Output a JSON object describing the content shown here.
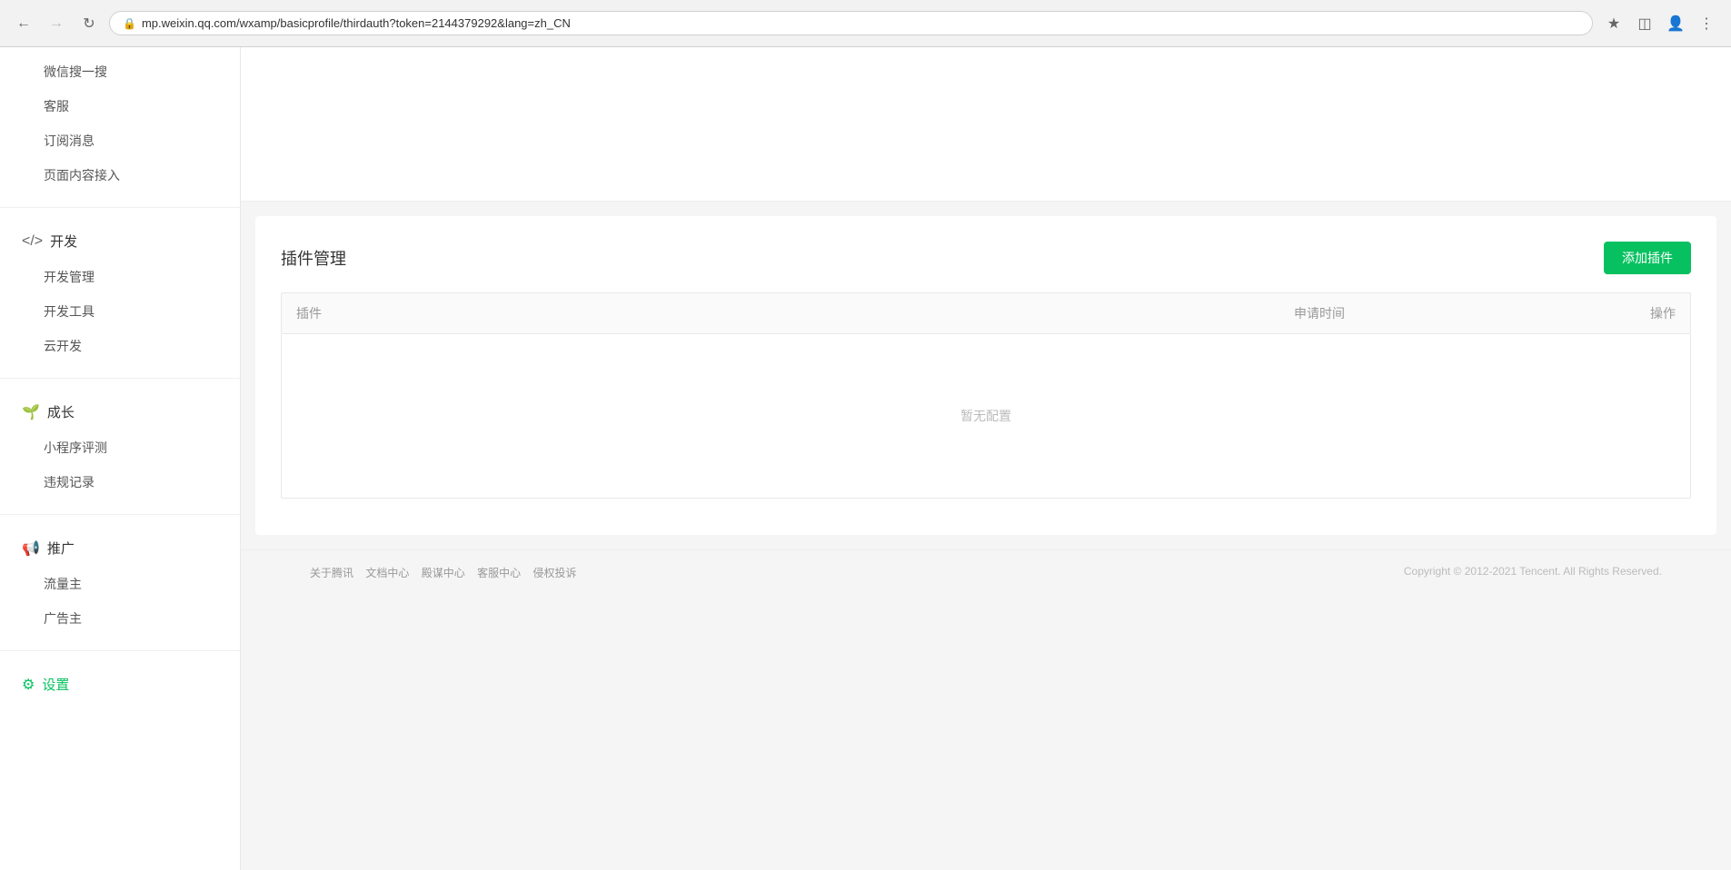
{
  "browser": {
    "url": "mp.weixin.qq.com/wxamp/basicprofile/thirdauth?token=2144379292&lang=zh_CN",
    "back_disabled": false,
    "forward_disabled": true
  },
  "sidebar": {
    "sections": [
      {
        "id": "weixin-search",
        "label": "微信搜一搜",
        "icon": "",
        "items": []
      },
      {
        "id": "kefu",
        "label": "客服",
        "icon": "",
        "items": []
      },
      {
        "id": "subscribe",
        "label": "订阅消息",
        "icon": "",
        "items": []
      },
      {
        "id": "page-content",
        "label": "页面内容接入",
        "icon": "",
        "items": []
      }
    ],
    "dev_section": {
      "label": "开发",
      "icon": "</>",
      "items": [
        "开发管理",
        "开发工具",
        "云开发"
      ]
    },
    "growth_section": {
      "label": "成长",
      "icon": "🌱",
      "items": [
        "小程序评测",
        "违规记录"
      ]
    },
    "promote_section": {
      "label": "推广",
      "icon": "📢",
      "items": [
        "流量主",
        "广告主"
      ]
    },
    "settings_section": {
      "label": "设置",
      "icon": "⚙",
      "active": true
    }
  },
  "plugin_management": {
    "title": "插件管理",
    "add_button_label": "添加插件",
    "table": {
      "col_plugin": "插件",
      "col_time": "申请时间",
      "col_action": "操作"
    },
    "empty_text": "暂无配置"
  },
  "footer": {
    "links": [
      "关于腾讯",
      "文档中心",
      "殿谋中心",
      "客服中心",
      "侵权投诉"
    ],
    "copyright": "Copyright © 2012-2021 Tencent. All Rights Reserved."
  }
}
